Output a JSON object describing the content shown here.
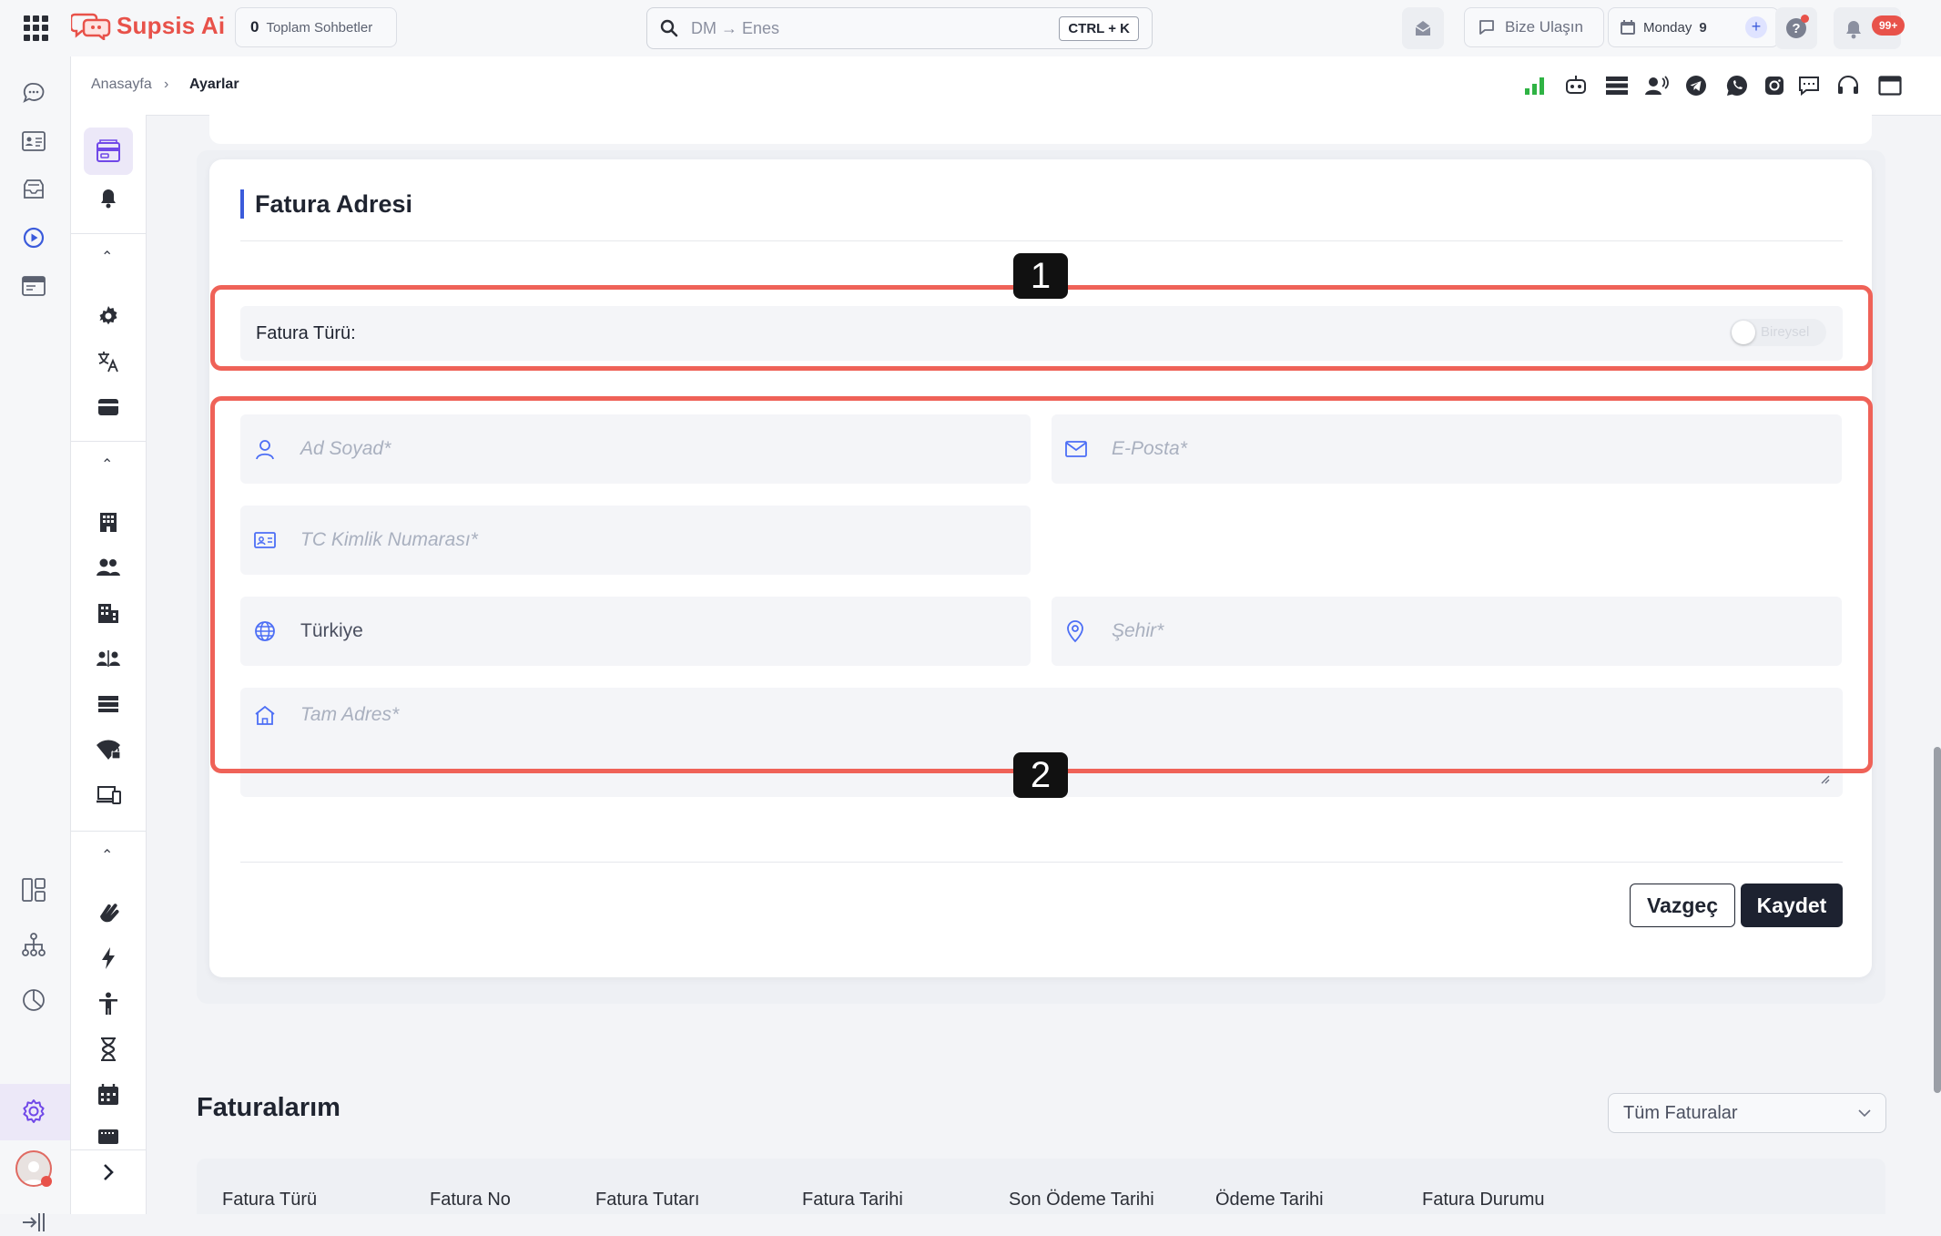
{
  "app": {
    "name": "Supsis Ai",
    "logo_icon": "chat-bubbles-logo",
    "brand_color": "#e8524a",
    "accent_color": "#3b5bdb"
  },
  "topbar": {
    "chat_count": "0",
    "chat_count_label": "Toplam Sohbetler",
    "search_placeholder": "DM → Enes",
    "search_shortcut": "CTRL + K",
    "contact_label": "Bize Ulaşın",
    "date_day": "Monday",
    "date_num": "9",
    "notifications_badge": "99+"
  },
  "breadcrumb": {
    "home": "Anasayfa",
    "separator": "›",
    "current": "Ayarlar"
  },
  "billing_address": {
    "title": "Fatura Adresi",
    "invoice_type_label": "Fatura Türü:",
    "toggle_label": "Bireysel",
    "toggle_on": false,
    "fields": {
      "name_placeholder": "Ad Soyad*",
      "email_placeholder": "E-Posta*",
      "tc_placeholder": "TC Kimlik Numarası*",
      "country_value": "Türkiye",
      "city_placeholder": "Şehir*",
      "address_placeholder": "Tam Adres*"
    },
    "cancel_label": "Vazgeç",
    "save_label": "Kaydet"
  },
  "annotations": [
    "1",
    "2"
  ],
  "invoices": {
    "title": "Faturalarım",
    "filter_value": "Tüm Faturalar",
    "columns": [
      "Fatura Türü",
      "Fatura No",
      "Fatura Tutarı",
      "Fatura Tarihi",
      "Son Ödeme Tarihi",
      "Ödeme Tarihi",
      "Fatura Durumu"
    ]
  }
}
